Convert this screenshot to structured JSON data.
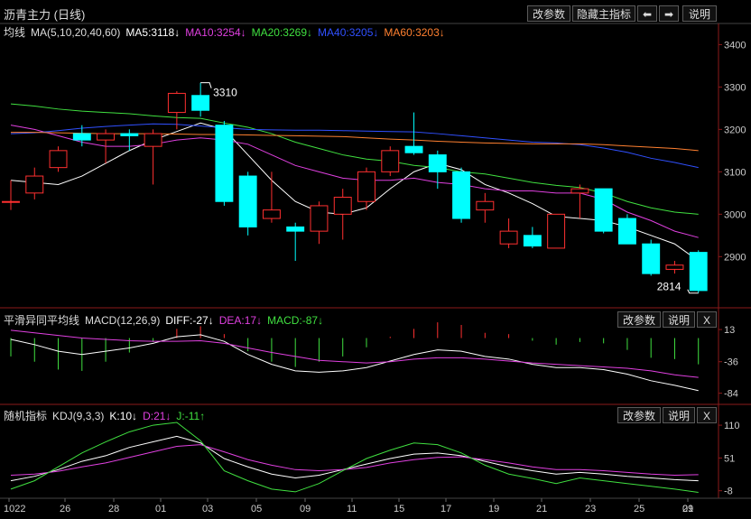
{
  "header": {
    "title": "沥青主力 (日线)",
    "buttons": [
      "改参数",
      "隐藏主指标",
      "⬅",
      "➡",
      "说明"
    ]
  },
  "main_panel": {
    "legend": [
      {
        "text": "均线",
        "color": "#dddddd"
      },
      {
        "text": "MA(5,10,20,40,60)",
        "color": "#dddddd"
      },
      {
        "text": "MA5:3118↓",
        "color": "#ffffff"
      },
      {
        "text": "MA10:3254↓",
        "color": "#e040e0"
      },
      {
        "text": "MA20:3269↓",
        "color": "#40e040"
      },
      {
        "text": "MA40:3205↓",
        "color": "#3050ff"
      },
      {
        "text": "MA60:3203↓",
        "color": "#ff8030"
      }
    ],
    "y_ticks": [
      "3400",
      "3300",
      "3200",
      "3100",
      "3000",
      "2900"
    ],
    "annotations": {
      "high": "3310",
      "low": "2814"
    }
  },
  "macd_panel": {
    "legend": [
      {
        "text": "平滑异同平均线",
        "color": "#dddddd"
      },
      {
        "text": "MACD(12,26,9)",
        "color": "#dddddd"
      },
      {
        "text": "DIFF:-27↓",
        "color": "#ffffff"
      },
      {
        "text": "DEA:17↓",
        "color": "#e040e0"
      },
      {
        "text": "MACD:-87↓",
        "color": "#40e040"
      }
    ],
    "buttons": [
      "改参数",
      "说明",
      "X"
    ],
    "y_ticks": [
      "13",
      "-36",
      "-84"
    ]
  },
  "kdj_panel": {
    "legend": [
      {
        "text": "随机指标",
        "color": "#dddddd"
      },
      {
        "text": "KDJ(9,3,3)",
        "color": "#dddddd"
      },
      {
        "text": "K:10↓",
        "color": "#ffffff"
      },
      {
        "text": "D:21↓",
        "color": "#e040e0"
      },
      {
        "text": "J:-11↑",
        "color": "#40e040"
      }
    ],
    "buttons": [
      "改参数",
      "说明",
      "X"
    ],
    "y_ticks": [
      "110",
      "51",
      "-8"
    ]
  },
  "x_ticks": [
    "1022",
    "26",
    "28",
    "01",
    "03",
    "05",
    "09",
    "11",
    "15",
    "17",
    "19",
    "21",
    "23",
    "25",
    "29",
    "01"
  ],
  "chart_data": [
    {
      "type": "candlestick",
      "title": "沥青主力 (日线)",
      "ylim": [
        2790,
        3420
      ],
      "candles": [
        {
          "o": 3030,
          "h": 3080,
          "l": 3010,
          "c": 3030
        },
        {
          "o": 3050,
          "h": 3110,
          "l": 3035,
          "c": 3090
        },
        {
          "o": 3110,
          "h": 3160,
          "l": 3100,
          "c": 3150
        },
        {
          "o": 3190,
          "h": 3210,
          "l": 3160,
          "c": 3175
        },
        {
          "o": 3175,
          "h": 3200,
          "l": 3120,
          "c": 3190
        },
        {
          "o": 3190,
          "h": 3200,
          "l": 3150,
          "c": 3185
        },
        {
          "o": 3160,
          "h": 3200,
          "l": 3070,
          "c": 3190
        },
        {
          "o": 3240,
          "h": 3290,
          "l": 3200,
          "c": 3285
        },
        {
          "o": 3280,
          "h": 3310,
          "l": 3230,
          "c": 3245
        },
        {
          "o": 3210,
          "h": 3220,
          "l": 3020,
          "c": 3030
        },
        {
          "o": 3090,
          "h": 3100,
          "l": 2950,
          "c": 2970
        },
        {
          "o": 2990,
          "h": 3100,
          "l": 2980,
          "c": 3010
        },
        {
          "o": 2970,
          "h": 2980,
          "l": 2890,
          "c": 2960
        },
        {
          "o": 2960,
          "h": 3030,
          "l": 2930,
          "c": 3020
        },
        {
          "o": 3000,
          "h": 3060,
          "l": 2940,
          "c": 3040
        },
        {
          "o": 3030,
          "h": 3110,
          "l": 3010,
          "c": 3100
        },
        {
          "o": 3100,
          "h": 3160,
          "l": 3090,
          "c": 3150
        },
        {
          "o": 3160,
          "h": 3240,
          "l": 3140,
          "c": 3145
        },
        {
          "o": 3140,
          "h": 3150,
          "l": 3060,
          "c": 3100
        },
        {
          "o": 3100,
          "h": 3110,
          "l": 2980,
          "c": 2990
        },
        {
          "o": 3010,
          "h": 3050,
          "l": 2980,
          "c": 3030
        },
        {
          "o": 2930,
          "h": 2990,
          "l": 2920,
          "c": 2960
        },
        {
          "o": 2950,
          "h": 2970,
          "l": 2920,
          "c": 2925
        },
        {
          "o": 2920,
          "h": 3000,
          "l": 2920,
          "c": 3000
        },
        {
          "o": 3050,
          "h": 3070,
          "l": 2990,
          "c": 3060
        },
        {
          "o": 3060,
          "h": 3060,
          "l": 2955,
          "c": 2960
        },
        {
          "o": 2990,
          "h": 3000,
          "l": 2930,
          "c": 2930
        },
        {
          "o": 2930,
          "h": 2940,
          "l": 2855,
          "c": 2860
        },
        {
          "o": 2870,
          "h": 2890,
          "l": 2860,
          "c": 2880
        },
        {
          "o": 2910,
          "h": 2915,
          "l": 2814,
          "c": 2820
        }
      ],
      "ma": {
        "MA5": [
          3080,
          3075,
          3070,
          3090,
          3120,
          3150,
          3175,
          3195,
          3215,
          3200,
          3140,
          3080,
          3030,
          3005,
          3000,
          3015,
          3060,
          3100,
          3120,
          3105,
          3070,
          3050,
          3025,
          2995,
          2990,
          2985,
          2970,
          2950,
          2930,
          2890
        ],
        "MA10": [
          3210,
          3200,
          3185,
          3170,
          3160,
          3160,
          3165,
          3175,
          3180,
          3175,
          3165,
          3140,
          3115,
          3100,
          3085,
          3080,
          3080,
          3085,
          3075,
          3070,
          3060,
          3055,
          3055,
          3050,
          3050,
          3035,
          3005,
          2985,
          2960,
          2945
        ],
        "MA20": [
          3260,
          3255,
          3248,
          3243,
          3240,
          3237,
          3232,
          3228,
          3226,
          3215,
          3205,
          3190,
          3170,
          3155,
          3140,
          3130,
          3125,
          3115,
          3110,
          3100,
          3095,
          3085,
          3075,
          3068,
          3063,
          3050,
          3030,
          3015,
          3005,
          3000
        ],
        "MA40": [
          3190,
          3192,
          3197,
          3203,
          3207,
          3210,
          3213,
          3212,
          3208,
          3204,
          3200,
          3199,
          3198,
          3198,
          3197,
          3196,
          3195,
          3194,
          3190,
          3185,
          3180,
          3175,
          3170,
          3168,
          3164,
          3156,
          3146,
          3132,
          3122,
          3110
        ],
        "MA60": [
          3193,
          3193,
          3192,
          3191,
          3190,
          3190,
          3190,
          3189,
          3188,
          3188,
          3187,
          3186,
          3185,
          3184,
          3183,
          3180,
          3177,
          3175,
          3172,
          3170,
          3168,
          3167,
          3166,
          3166,
          3166,
          3164,
          3161,
          3158,
          3155,
          3150
        ]
      }
    },
    {
      "type": "line",
      "title": "MACD(12,26,9)",
      "ylim": [
        -90,
        20
      ],
      "series": [
        {
          "name": "DIFF",
          "values": [
            -2,
            -10,
            -20,
            -25,
            -20,
            -15,
            -8,
            2,
            5,
            -5,
            -25,
            -40,
            -50,
            -52,
            -50,
            -45,
            -35,
            -25,
            -18,
            -20,
            -28,
            -32,
            -40,
            -45,
            -45,
            -48,
            -55,
            -65,
            -72,
            -80
          ]
        },
        {
          "name": "DEA",
          "values": [
            12,
            8,
            4,
            0,
            -2,
            -4,
            -5,
            -5,
            -4,
            -8,
            -15,
            -22,
            -28,
            -34,
            -36,
            -38,
            -36,
            -32,
            -30,
            -30,
            -32,
            -35,
            -38,
            -40,
            -42,
            -44,
            -46,
            -50,
            -56,
            -60
          ]
        },
        {
          "name": "MACD",
          "values": [
            -28,
            -36,
            -48,
            -50,
            -36,
            -22,
            -6,
            14,
            18,
            6,
            -20,
            -36,
            -44,
            -36,
            -28,
            -14,
            2,
            14,
            24,
            20,
            8,
            6,
            -4,
            -10,
            -6,
            -8,
            -18,
            -30,
            -32,
            -40
          ]
        }
      ]
    },
    {
      "type": "line",
      "title": "KDJ(9,3,3)",
      "ylim": [
        -15,
        115
      ],
      "series": [
        {
          "name": "K",
          "values": [
            10,
            18,
            30,
            45,
            55,
            70,
            80,
            90,
            78,
            50,
            35,
            22,
            15,
            20,
            30,
            40,
            50,
            58,
            60,
            55,
            45,
            35,
            28,
            22,
            25,
            22,
            18,
            15,
            12,
            10
          ]
        },
        {
          "name": "D",
          "values": [
            20,
            22,
            27,
            35,
            42,
            52,
            62,
            72,
            75,
            62,
            48,
            38,
            30,
            28,
            30,
            34,
            42,
            48,
            52,
            53,
            48,
            42,
            35,
            30,
            30,
            28,
            25,
            22,
            20,
            21
          ]
        },
        {
          "name": "J",
          "values": [
            -5,
            10,
            35,
            60,
            80,
            98,
            110,
            115,
            82,
            28,
            10,
            -5,
            -10,
            5,
            28,
            50,
            65,
            78,
            75,
            60,
            38,
            22,
            14,
            5,
            15,
            10,
            5,
            0,
            -5,
            -11
          ]
        }
      ]
    }
  ]
}
